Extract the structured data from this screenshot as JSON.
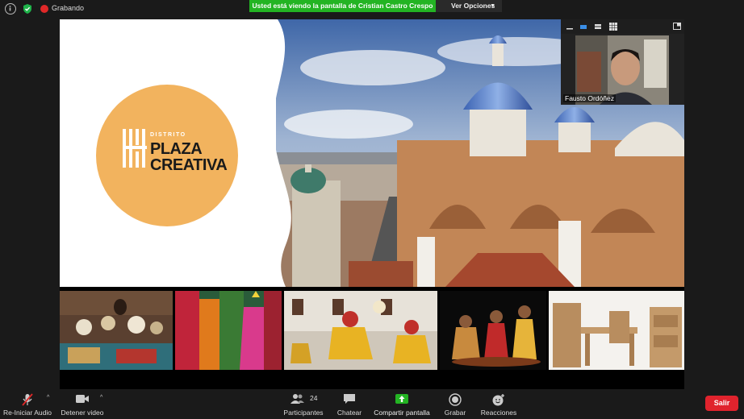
{
  "topbar": {
    "recording_label": "Grabando",
    "banner_text": "Usted está viendo la pantalla de Cristian Castro Crespo",
    "view_options_label": "Ver Opciones"
  },
  "slide": {
    "logo_small": "DISTRITO",
    "logo_line1": "PLAZA",
    "logo_line2": "CREATIVA",
    "brand_color": "#f2b35e"
  },
  "selfview": {
    "participant_name": "Fausto Ordóñez"
  },
  "toolbar": {
    "audio_label": "Re-Iniciar Audio",
    "video_label": "Detener video",
    "participants_label": "Participantes",
    "participants_count": "24",
    "chat_label": "Chatear",
    "share_label": "Compartir pantalla",
    "record_label": "Grabar",
    "reactions_label": "Reacciones",
    "exit_label": "Salir"
  },
  "colors": {
    "share_green": "#23b423",
    "exit_red": "#e0232d",
    "record_red": "#e02828"
  }
}
